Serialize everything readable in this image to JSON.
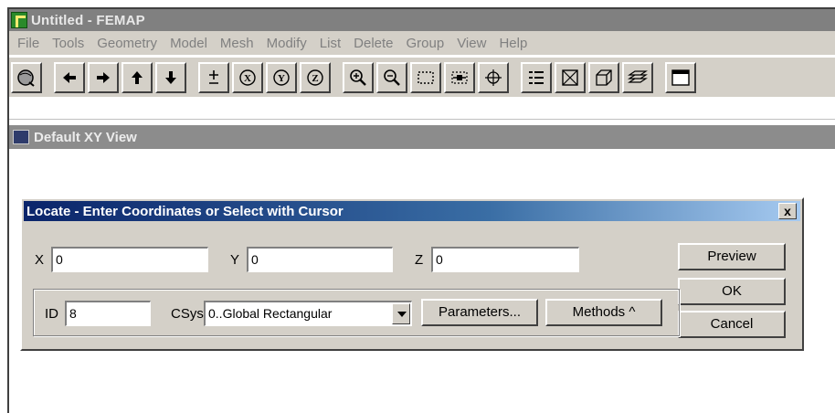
{
  "app": {
    "title": "Untitled - FEMAP"
  },
  "menu": [
    "File",
    "Tools",
    "Geometry",
    "Model",
    "Mesh",
    "Modify",
    "List",
    "Delete",
    "Group",
    "View",
    "Help"
  ],
  "toolbar": {
    "buttons": [
      "globe-icon",
      "arrow-left-icon",
      "arrow-right-icon",
      "arrow-up-icon",
      "arrow-down-icon",
      "plus-minus-icon",
      "rotate-x-icon",
      "rotate-y-icon",
      "rotate-z-icon",
      "zoom-in-icon",
      "zoom-out-icon",
      "zoom-box-icon",
      "zoom-fit-icon",
      "crosshair-icon",
      "list-icon",
      "box-x-icon",
      "cube-icon",
      "layers-icon",
      "window-icon"
    ],
    "rotate_labels": {
      "x": "X",
      "y": "Y",
      "z": "Z"
    }
  },
  "view": {
    "title": "Default XY View"
  },
  "dialog": {
    "title": "Locate - Enter Coordinates or Select with Cursor",
    "close_label": "x",
    "x_label": "X",
    "x_value": "0",
    "y_label": "Y",
    "y_value": "0",
    "z_label": "Z",
    "z_value": "0",
    "id_label": "ID",
    "id_value": "8",
    "csys_label": "CSys",
    "csys_value": "0..Global Rectangular",
    "parameters_label": "Parameters...",
    "methods_label": "Methods ^",
    "preview_label": "Preview",
    "ok_label": "OK",
    "cancel_label": "Cancel"
  }
}
